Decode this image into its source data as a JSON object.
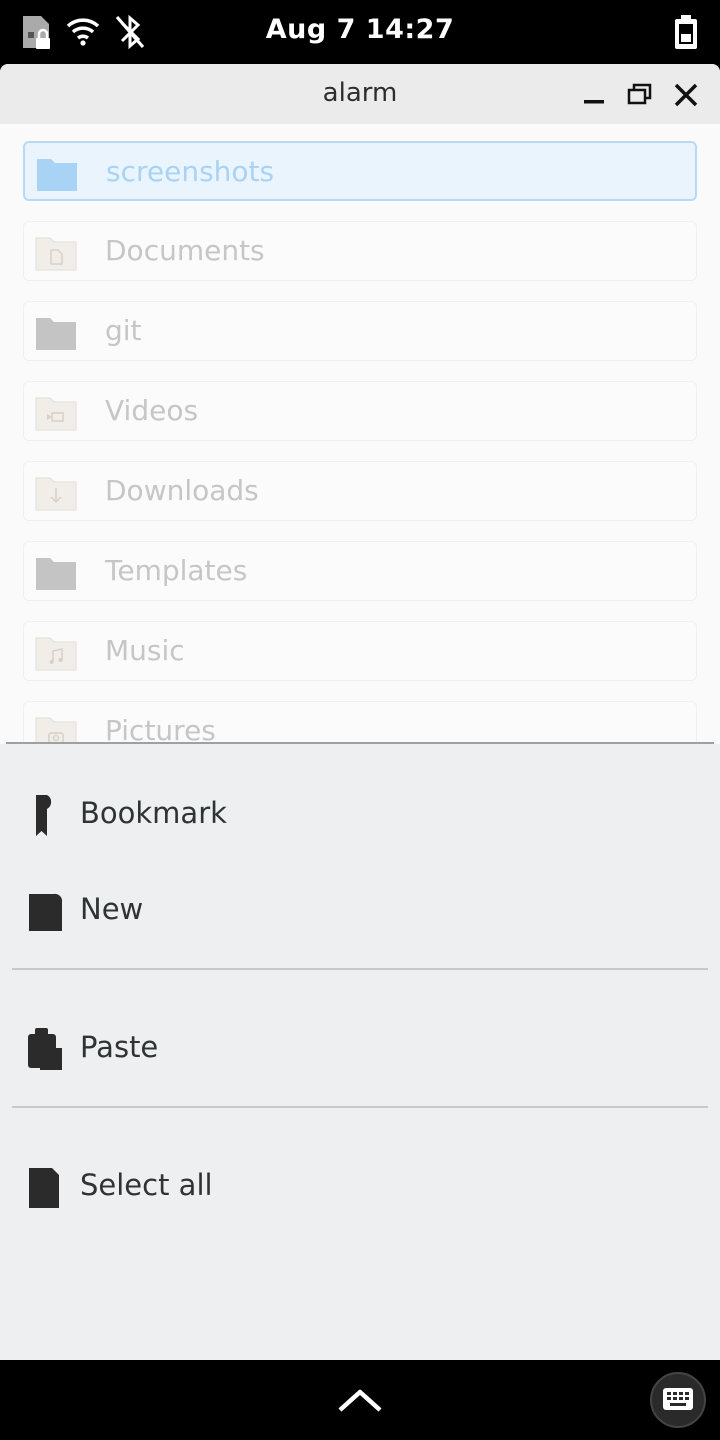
{
  "status_bar": {
    "clock": "Aug 7  14:27",
    "icons": [
      "sim-lock-icon",
      "wifi-icon",
      "bluetooth-off-icon",
      "battery-icon"
    ]
  },
  "window": {
    "title": "alarm",
    "controls": [
      "minimize-icon",
      "maximize-icon",
      "close-icon"
    ]
  },
  "files": [
    {
      "name": "screenshots",
      "icon": "folder-icon",
      "selected": true
    },
    {
      "name": "Documents",
      "icon": "folder-documents-icon"
    },
    {
      "name": "git",
      "icon": "folder-icon"
    },
    {
      "name": "Videos",
      "icon": "folder-videos-icon"
    },
    {
      "name": "Downloads",
      "icon": "folder-download-icon"
    },
    {
      "name": "Templates",
      "icon": "folder-icon"
    },
    {
      "name": "Music",
      "icon": "folder-music-icon"
    },
    {
      "name": "Pictures",
      "icon": "folder-pictures-icon"
    }
  ],
  "context_menu": {
    "bookmark": "Bookmark",
    "new": "New",
    "paste": "Paste",
    "select_all": "Select all"
  },
  "bottom_bar": {
    "icons": [
      "chevron-up-icon",
      "keyboard-icon"
    ]
  },
  "colors": {
    "selection_bg": "#eaf4fc",
    "selection_border": "#b9d9f3",
    "folder_blue": "#a9d3f5",
    "menu_bg": "#eeeff1",
    "text_dark": "#2e3436"
  }
}
